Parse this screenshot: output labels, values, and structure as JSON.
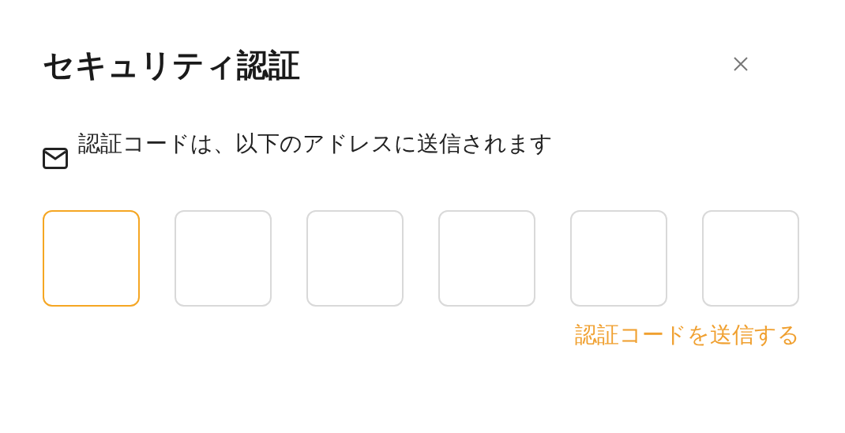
{
  "dialog": {
    "title": "セキュリティ認証"
  },
  "message": "認証コードは、以下のアドレスに送信されます",
  "code_boxes": [
    {
      "selected": true
    },
    {
      "selected": false
    },
    {
      "selected": false
    },
    {
      "selected": false
    },
    {
      "selected": false
    },
    {
      "selected": false
    }
  ],
  "send_code_link": "認証コードを送信する"
}
